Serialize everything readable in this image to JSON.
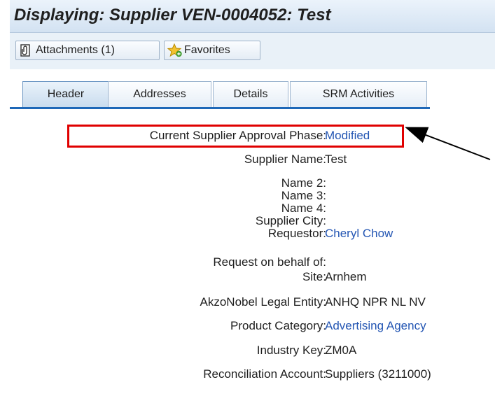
{
  "title": "Displaying: Supplier VEN-0004052: Test",
  "toolbar": {
    "attachments_label": "Attachments (1)",
    "favorites_label": "Favorites"
  },
  "tabs": [
    {
      "label": "Header",
      "active": true
    },
    {
      "label": "Addresses",
      "active": false
    },
    {
      "label": "Details",
      "active": false
    },
    {
      "label": "SRM Activities",
      "active": false
    }
  ],
  "fields": [
    {
      "label": "Current Supplier Approval Phase:",
      "value": "Modified",
      "link": true
    },
    {
      "label": "Supplier Name:",
      "value": "Test",
      "link": false
    },
    {
      "label": "Name 2:",
      "value": "",
      "link": false
    },
    {
      "label": "Name 3:",
      "value": "",
      "link": false
    },
    {
      "label": "Name 4:",
      "value": "",
      "link": false
    },
    {
      "label": "Supplier City:",
      "value": "",
      "link": false
    },
    {
      "label": "Requestor:",
      "value": "Cheryl Chow",
      "link": true
    },
    {
      "label": "Request on behalf of:",
      "value": "",
      "link": false
    },
    {
      "label": "Site:",
      "value": "Arnhem",
      "link": false
    },
    {
      "label": "AkzoNobel Legal Entity:",
      "value": "ANHQ NPR NL NV",
      "link": false
    },
    {
      "label": "Product Category:",
      "value": "Advertising Agency",
      "link": true
    },
    {
      "label": "Industry Key:",
      "value": "ZM0A",
      "link": false
    },
    {
      "label": "Reconciliation Account:",
      "value": "Suppliers (3211000)",
      "link": false
    }
  ],
  "colors": {
    "link": "#2456b3",
    "highlight": "#e00000",
    "tab_accent": "#1e68b8"
  },
  "icons": [
    "paperclip-icon",
    "star-plus-icon",
    "arrow-annotation"
  ]
}
